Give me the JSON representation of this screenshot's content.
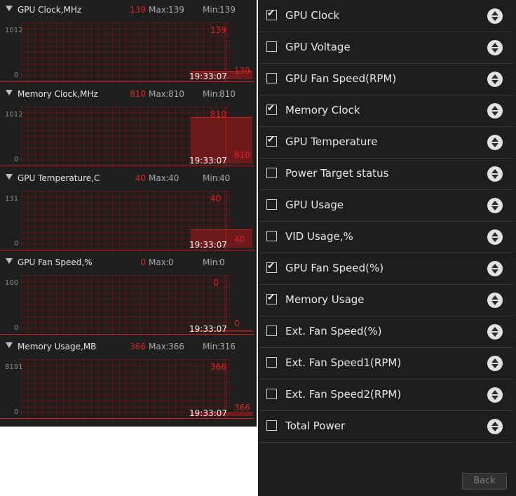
{
  "monitors": [
    {
      "title": "GPU Clock,MHz",
      "current": "139",
      "max_label": "Max:",
      "max_value": "139",
      "min_label": "Min:",
      "min_value": "139",
      "y_top": "1012",
      "y_bottom": "0",
      "graph_value": "139",
      "graph_value_right": "139",
      "time": "19:33:07",
      "level": 0.14
    },
    {
      "title": "Memory Clock,MHz",
      "current": "810",
      "max_label": "Max:",
      "max_value": "810",
      "min_label": "Min:",
      "min_value": "810",
      "y_top": "1012",
      "y_bottom": "0",
      "graph_value": "810",
      "graph_value_right": "810",
      "time": "19:33:07",
      "level": 0.8
    },
    {
      "title": "GPU Temperature,C",
      "current": "40",
      "max_label": "Max:",
      "max_value": "40",
      "min_label": "Min:",
      "min_value": "40",
      "y_top": "131",
      "y_bottom": "0",
      "graph_value": "40",
      "graph_value_right": "40",
      "time": "19:33:07",
      "level": 0.31
    },
    {
      "title": "GPU Fan Speed,%",
      "current": "0",
      "max_label": "Max:",
      "max_value": "0",
      "min_label": "Min:",
      "min_value": "0",
      "y_top": "100",
      "y_bottom": "0",
      "graph_value": "0",
      "graph_value_right": "0",
      "time": "19:33:07",
      "level": 0.0
    },
    {
      "title": "Memory Usage,MB",
      "current": "366",
      "max_label": "Max:",
      "max_value": "366",
      "min_label": "Min:",
      "min_value": "316",
      "y_top": "8191",
      "y_bottom": "0",
      "graph_value": "366",
      "graph_value_right": "366",
      "time": "19:33:07",
      "level": 0.045
    }
  ],
  "options": [
    {
      "label": "GPU Clock",
      "checked": true
    },
    {
      "label": "GPU Voltage",
      "checked": false
    },
    {
      "label": "GPU Fan Speed(RPM)",
      "checked": false
    },
    {
      "label": "Memory Clock",
      "checked": true
    },
    {
      "label": "GPU Temperature",
      "checked": true
    },
    {
      "label": "Power Target status",
      "checked": false
    },
    {
      "label": "GPU Usage",
      "checked": false
    },
    {
      "label": "VID Usage,%",
      "checked": false
    },
    {
      "label": "GPU Fan Speed(%)",
      "checked": true
    },
    {
      "label": "Memory Usage",
      "checked": true
    },
    {
      "label": "Ext. Fan Speed(%)",
      "checked": false
    },
    {
      "label": "Ext. Fan Speed1(RPM)",
      "checked": false
    },
    {
      "label": "Ext. Fan Speed2(RPM)",
      "checked": false
    },
    {
      "label": "Total Power",
      "checked": false
    }
  ],
  "icons": {
    "checkmark": "✔",
    "collapse": "triangle-down-icon",
    "sort": "sort-up-down-icon"
  },
  "back_label": "Back",
  "colors": {
    "accent": "#e02020",
    "grid": "#781616",
    "panel": "#1e1e1e"
  }
}
